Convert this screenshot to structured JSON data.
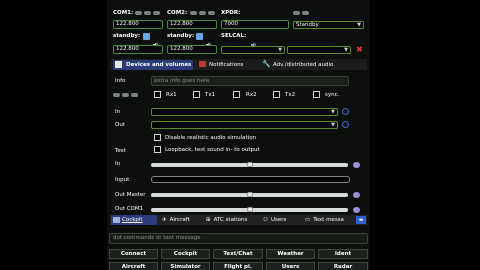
{
  "top": {
    "com1_label": "COM1:",
    "com2_label": "COM2:",
    "xpdr_label": "XPDR:",
    "com1_active": "122.800",
    "com2_active": "122.800",
    "xpdr_code": "7000",
    "xpdr_mode": "Standby",
    "standby1_label": "standby:",
    "standby2_label": "standby:",
    "selcal_label": "SELCAL:",
    "com1_standby": "122.800",
    "com2_standby": "122.800"
  },
  "tabs_top": {
    "devices": "Devices and volumes",
    "notifications": "Notifications",
    "advanced": "Adv./distributed audio"
  },
  "devices": {
    "info_label": "Info",
    "info_placeholder": "extra info goes here",
    "rx1": "Rx1",
    "tx1": "Tx1",
    "rx2": "Rx2",
    "tx2": "Tx2",
    "sync": "sync.",
    "in_label": "In",
    "out_label": "Out",
    "disable_sim": "Disable realistic audio simulation",
    "test_label": "Test",
    "loopback": "Loopback, test sound in- to output",
    "in2_label": "In",
    "input_label": "Input",
    "out_master_label": "Out Master",
    "out_com_label": "Out COM1"
  },
  "tabs_bottom": {
    "cockpit": "Cockpit",
    "aircraft": "Aircraft",
    "atc": "ATC stations",
    "users": "Users",
    "text": "Text messa"
  },
  "command": {
    "placeholder": "dot commands or text message"
  },
  "buttons": {
    "row1": [
      "Connect",
      "Cockpit",
      "Text/Chat",
      "Weather",
      "Ident"
    ],
    "row2": [
      "Aircraft",
      "Simulator",
      "Flight pl.",
      "Users",
      "Radar"
    ]
  },
  "colors": {
    "panel": "#0c0f0c",
    "accent_blue": "#3d6fd6",
    "border_green": "#4b8a34"
  }
}
